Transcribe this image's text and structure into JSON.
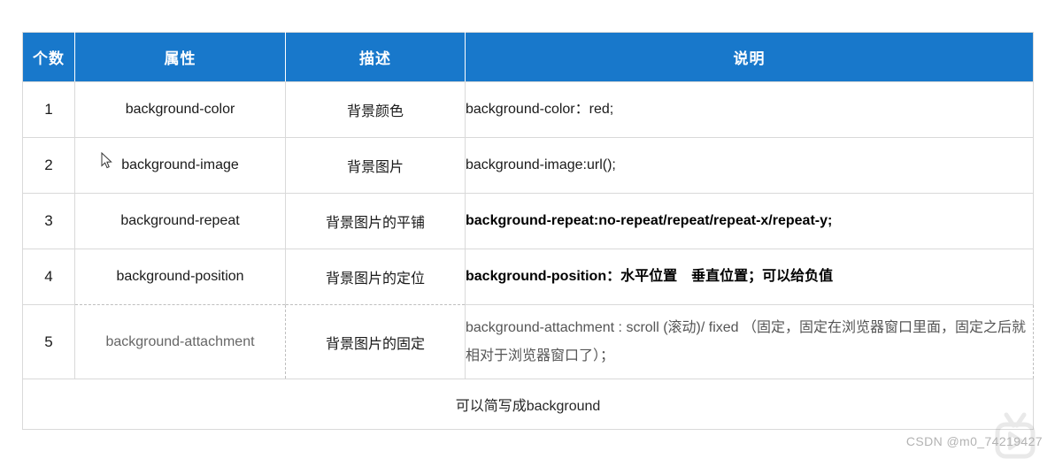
{
  "table": {
    "headers": [
      {
        "key": "count",
        "label": "个数"
      },
      {
        "key": "property",
        "label": "属性"
      },
      {
        "key": "description",
        "label": "描述"
      },
      {
        "key": "note",
        "label": "说明"
      }
    ],
    "rows": [
      {
        "count": "1",
        "property": "background-color",
        "description": "背景颜色",
        "note": "background-color：red;"
      },
      {
        "count": "2",
        "property": "background-image",
        "description": "背景图片",
        "note": "background-image:url();"
      },
      {
        "count": "3",
        "property": "background-repeat",
        "description": "背景图片的平铺",
        "note": "background-repeat:no-repeat/repeat/repeat-x/repeat-y;"
      },
      {
        "count": "4",
        "property": "background-position",
        "description": "背景图片的定位",
        "note": "background-position：水平位置　垂直位置；可以给负值"
      },
      {
        "count": "5",
        "property": "background-attachment",
        "description": "背景图片的固定",
        "note": "background-attachment : scroll (滚动)/ fixed （固定，固定在浏览器窗口里面，固定之后就相对于浏览器窗口了）；"
      }
    ],
    "summary": "可以简写成background"
  },
  "watermark": {
    "text": "CSDN @m0_74219427"
  },
  "colors": {
    "header_blue": "#1878cb",
    "border_gray": "#d9d9d9",
    "dashed_gray": "#bfbfbf",
    "text_dark": "#1a1a1a",
    "watermark_gray": "#b3b3b3"
  }
}
